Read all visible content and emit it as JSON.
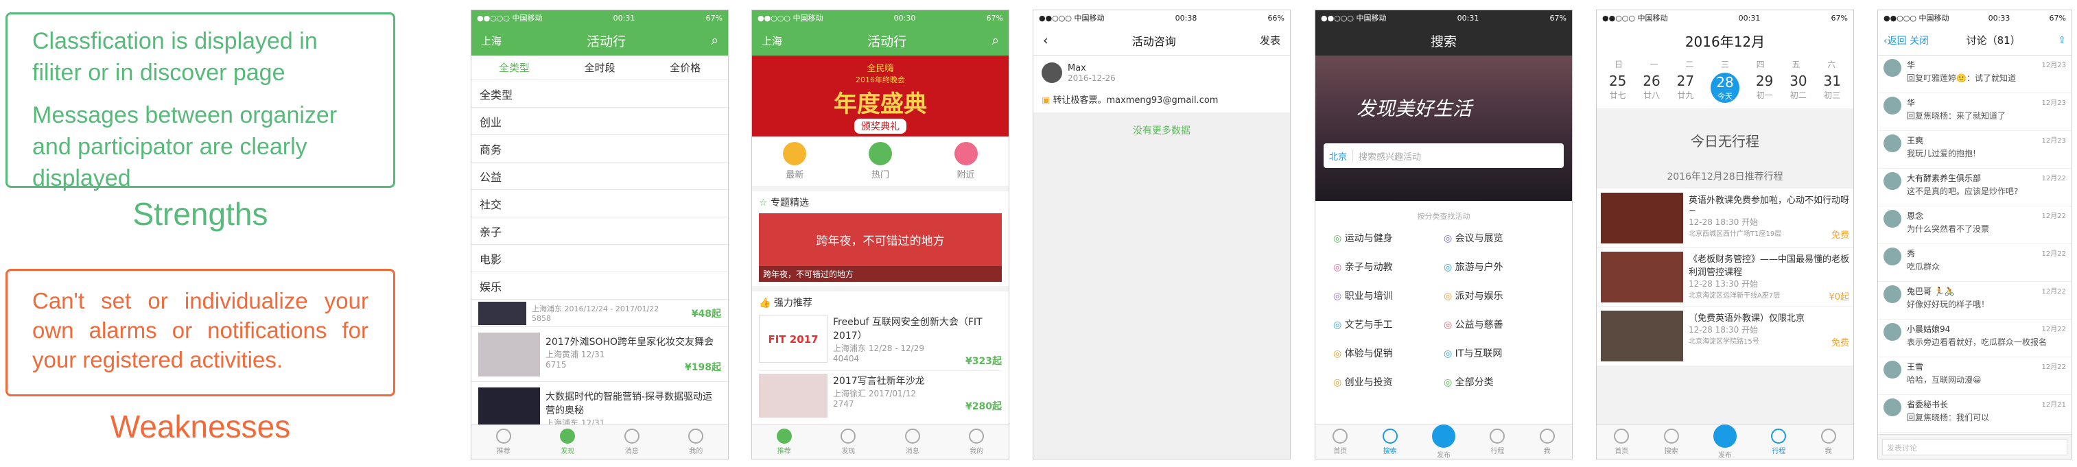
{
  "left": {
    "strength_lines": [
      "Classfication is displayed in filiter or in discover page",
      "Messages between organizer and participator are clearly displayed"
    ],
    "strengths_caption": "Strengths",
    "weakness_text": "Can't set or individualize your own alarms or notifications for your registered activities.",
    "weaknesses_caption": "Weaknesses"
  },
  "p1": {
    "carrier": "●●○○○ 中国移动",
    "time": "00:31",
    "battery": "67%",
    "city": "上海",
    "title": "活动行",
    "filters": [
      "全类型",
      "全时段",
      "全价格"
    ],
    "menu": [
      "全类型",
      "创业",
      "商务",
      "公益",
      "社交",
      "亲子",
      "电影",
      "娱乐"
    ],
    "partial": {
      "loc": "上海浦东",
      "date": "2016/12/24 - 2017/01/22",
      "views": "5858",
      "price": "¥48起"
    },
    "items": [
      {
        "title": "2017外滩SOHO跨年皇家化妆交友舞会",
        "loc": "上海黄浦",
        "date": "12/31",
        "views": "6715",
        "price": "¥198起"
      },
      {
        "title": "大数据时代的智能营销-探寻数据驱动运营的奥秘",
        "loc": "上海浦东",
        "date": "12/31",
        "views": "",
        "price": ""
      }
    ],
    "tabs": [
      "推荐",
      "发现",
      "消息",
      "我的"
    ]
  },
  "p2": {
    "carrier": "●●○○○ 中国移动",
    "time": "00:30",
    "battery": "67%",
    "city": "上海",
    "title": "活动行",
    "banner_top": "全民嗨",
    "banner_sub": "2016年终晚会",
    "banner_main": "年度盛典",
    "banner_bottom": "颁奖典礼",
    "cats": [
      "最新",
      "热门",
      "附近"
    ],
    "sec1": "专题精选",
    "feature": "跨年夜，不可错过的地方",
    "feature_cap": "跨年夜，不可错过的地方",
    "sec2": "强力推荐",
    "items": [
      {
        "title": "Freebuf 互联网安全创新大会（FIT 2017）",
        "loc": "上海浦东",
        "date": "12/28 - 12/29",
        "views": "40404",
        "price": "¥323起",
        "thumb": "FIT 2017"
      },
      {
        "title": "2017写言社新年沙龙",
        "loc": "上海徐汇",
        "date": "2017/01/12",
        "views": "2747",
        "price": "¥280起",
        "thumb": ""
      }
    ],
    "tabs": [
      "推荐",
      "发现",
      "消息",
      "我的"
    ]
  },
  "p3": {
    "carrier": "●●○○○ 中国移动",
    "time": "00:38",
    "battery": "66%",
    "title": "活动咨询",
    "publish": "发表",
    "user": "Max",
    "date": "2016-12-26",
    "msg": "转让极客票。maxmeng93@gmail.com",
    "more": "没有更多数据"
  },
  "p4": {
    "carrier": "●●○○○ 中国移动",
    "time": "00:31",
    "battery": "67%",
    "title": "搜索",
    "slogan": "发现美好生活",
    "city": "北京",
    "search_ph": "搜索感兴趣活动",
    "divider": "按分类查找活动",
    "cats": [
      "运动与健身",
      "会议与展览",
      "亲子与动教",
      "旅游与户外",
      "职业与培训",
      "派对与娱乐",
      "文艺与手工",
      "公益与慈善",
      "体验与促销",
      "IT与互联网",
      "创业与投资",
      "全部分类"
    ],
    "tabs": [
      "首页",
      "搜索",
      "发布",
      "行程",
      "我"
    ]
  },
  "p5": {
    "carrier": "●●○○○ 中国移动",
    "time": "00:31",
    "battery": "67%",
    "title": "2016年12月",
    "weekdays": [
      "日",
      "一",
      "二",
      "三",
      "四",
      "五",
      "六"
    ],
    "days": [
      "25",
      "26",
      "27",
      "28",
      "29",
      "30",
      "31"
    ],
    "lunar": [
      "廿七",
      "廿八",
      "廿九",
      "今天",
      "初一",
      "初二",
      "初三"
    ],
    "empty": "今日无行程",
    "rec": "2016年12月28日推荐行程",
    "items": [
      {
        "title": "英语外教课免费参加啦，心动不如行动呀~",
        "meta": "12-28 18:30 开始",
        "loc": "北京西城区西什广场T1座19层",
        "price": "免费"
      },
      {
        "title": "《老板财务管控》——中国最易懂的老板利润管控课程",
        "meta": "12-28 13:30 开始",
        "loc": "北京海淀区远洋新干线A座7层",
        "price": "¥0起"
      },
      {
        "title": "（免费英语外教课）仅限北京",
        "meta": "12-28 18:30 开始",
        "loc": "北京海淀区学院路15号",
        "price": "免费"
      }
    ],
    "tabs": [
      "首页",
      "搜索",
      "发布",
      "行程",
      "我"
    ]
  },
  "p6": {
    "carrier": "●●○○○ 中国移动",
    "time": "00:33",
    "battery": "67%",
    "back": "返回",
    "close": "关闭",
    "title": "讨论（81）",
    "msgs": [
      {
        "name": "华",
        "text": "回复叮雅莲婷🙂：试了就知道",
        "date": "12月23"
      },
      {
        "name": "华",
        "text": "回复焦晓杨：来了就知道了",
        "date": "12月23"
      },
      {
        "name": "王爽",
        "text": "我玩儿过爱的抱抱!",
        "date": "12月23"
      },
      {
        "name": "大有酵素养生俱乐部",
        "text": "这不是真的吧。应该是炒作吧?",
        "date": "12月22"
      },
      {
        "name": "恩念",
        "text": "为什么突然看不了没票",
        "date": "12月22"
      },
      {
        "name": "秀",
        "text": "吃瓜群众",
        "date": "12月22"
      },
      {
        "name": "兔巴哥 🏃🚴",
        "text": "好像好好玩的样子哦！",
        "date": "12月22"
      },
      {
        "name": "小晨姑娘94",
        "text": "表示旁边看看就好，吃瓜群众一枚报名",
        "date": "12月22"
      },
      {
        "name": "王雪",
        "text": "哈哈，互联网动漫😀",
        "date": "12月22"
      },
      {
        "name": "省委秘书长",
        "text": "回复焦晓杨：我们可以",
        "date": "12月21"
      }
    ],
    "input_ph": "发表讨论"
  },
  "colors": {
    "green": "#5cb95a",
    "orange": "#f06a3a",
    "blue": "#1a9be6"
  }
}
